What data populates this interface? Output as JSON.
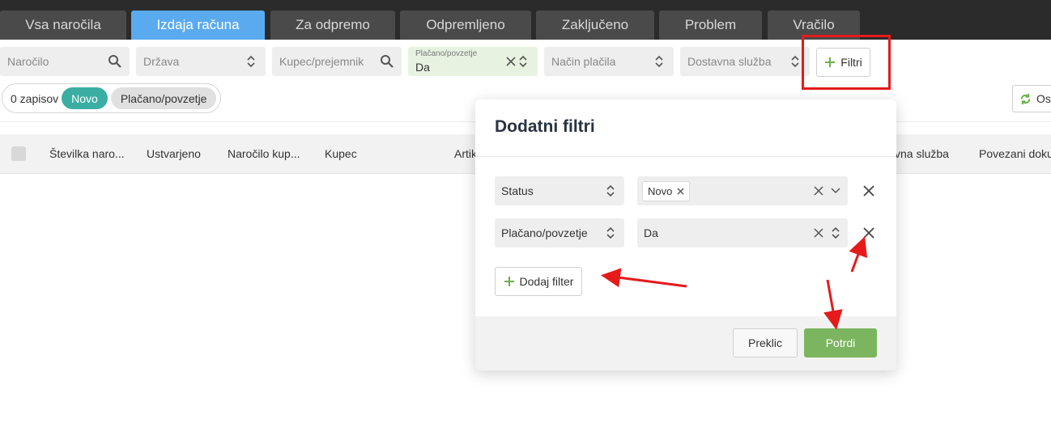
{
  "tabs": [
    {
      "label": "Vsa naročila",
      "active": false
    },
    {
      "label": "Izdaja računa",
      "active": true
    },
    {
      "label": "Za odpremo",
      "active": false
    },
    {
      "label": "Odpremljeno",
      "active": false
    },
    {
      "label": "Zaključeno",
      "active": false
    },
    {
      "label": "Problem",
      "active": false
    },
    {
      "label": "Vračilo",
      "active": false
    }
  ],
  "filters": {
    "order_placeholder": "Naročilo",
    "country_placeholder": "Država",
    "customer_placeholder": "Kupec/prejemnik",
    "paid_label": "Plačano/povzetje",
    "paid_value": "Da",
    "payment_placeholder": "Način plačila",
    "delivery_placeholder": "Dostavna služba",
    "filters_button": "Filtri"
  },
  "summary": {
    "records": "0 zapisov",
    "chips": [
      "Novo",
      "Plačano/povzetje"
    ]
  },
  "refresh_button_partial": "Os",
  "table": {
    "headers_left": [
      "Številka naro...",
      "Ustvarjeno",
      "Naročilo kup...",
      "Kupec",
      "Artik"
    ],
    "headers_right": [
      "vna služba",
      "Povezani doku"
    ]
  },
  "modal": {
    "title": "Dodatni filtri",
    "rows": [
      {
        "field": "Status",
        "tag": "Novo"
      },
      {
        "field": "Plačano/povzetje",
        "value": "Da"
      }
    ],
    "add_filter": "Dodaj filter",
    "cancel": "Preklic",
    "confirm": "Potrdi"
  },
  "colors": {
    "tab_active": "#5aaaf0",
    "chip_new": "#3aaea3",
    "confirm_button": "#7cb560",
    "highlight_red": "#e51b1b"
  }
}
